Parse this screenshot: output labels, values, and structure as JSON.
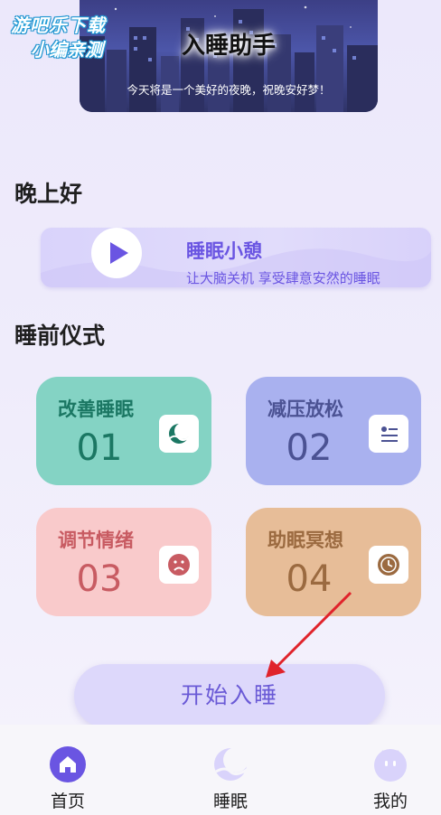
{
  "watermark": {
    "line1": "游吧乐下载",
    "line2": "小编亲测"
  },
  "banner": {
    "title": "入睡助手",
    "subtitle": "今天将是一个美好的夜晚，祝晚安好梦！"
  },
  "greeting": "晚上好",
  "nap": {
    "title": "睡眠小憩",
    "subtitle": "让大脑关机 享受肆意安然的睡眠",
    "icon": "play-icon"
  },
  "ritual": {
    "title": "睡前仪式",
    "cards": [
      {
        "title": "改善睡眠",
        "number": "01",
        "icon": "moon-wave-icon",
        "color": "#84d3c4"
      },
      {
        "title": "减压放松",
        "number": "02",
        "icon": "list-person-icon",
        "color": "#a9b1ef"
      },
      {
        "title": "调节情绪",
        "number": "03",
        "icon": "sad-face-icon",
        "color": "#f9cacb"
      },
      {
        "title": "助眠冥想",
        "number": "04",
        "icon": "meditation-clock-icon",
        "color": "#e7bd98"
      }
    ]
  },
  "start_button": "开始入睡",
  "nav": [
    {
      "label": "首页",
      "icon": "home-icon",
      "active": true
    },
    {
      "label": "睡眠",
      "icon": "moon-icon",
      "active": false
    },
    {
      "label": "我的",
      "icon": "face-icon",
      "active": false
    }
  ],
  "colors": {
    "accent": "#6a55e2",
    "nav_active": "#6a55e2",
    "nav_inactive": "#d9d3fb"
  }
}
